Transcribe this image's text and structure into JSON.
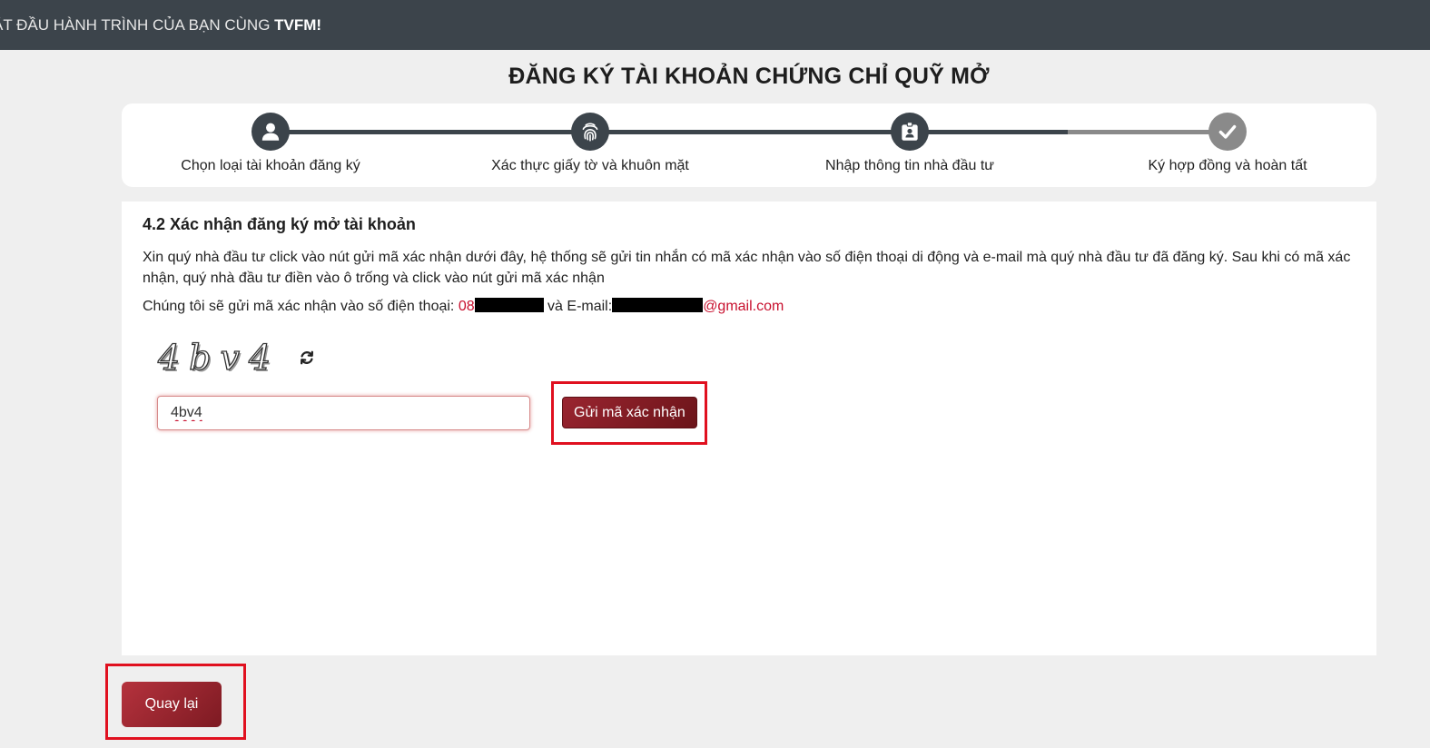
{
  "topbar": {
    "text_prefix": "ẮT ĐẦU HÀNH TRÌNH CỦA BẠN CÙNG ",
    "brand": "TVFM!"
  },
  "page_title": "ĐĂNG KÝ TÀI KHOẢN CHỨNG CHỈ QUỸ MỞ",
  "steps": [
    {
      "label": "Chọn loại tài khoản đăng ký",
      "icon": "user-icon",
      "status": "done"
    },
    {
      "label": "Xác thực giấy tờ và khuôn mặt",
      "icon": "fingerprint-icon",
      "status": "done"
    },
    {
      "label": "Nhập thông tin nhà đầu tư",
      "icon": "id-badge-icon",
      "status": "done"
    },
    {
      "label": "Ký hợp đồng và hoàn tất",
      "icon": "check-icon",
      "status": "pending"
    }
  ],
  "section": {
    "title": "4.2 Xác nhận đăng ký mở tài khoản",
    "instructions": "Xin quý nhà đầu tư click vào nút gửi mã xác nhận dưới đây, hệ thống sẽ gửi tin nhắn có mã xác nhận vào số điện thoại di động và e-mail mà quý nhà đầu tư đã đăng ký. Sau khi có mã xác nhận, quý nhà đầu tư điền vào ô trống và click vào nút gửi mã xác nhận",
    "send_info_prefix": "Chúng tôi sẽ gửi mã xác nhận vào số điện thoại: ",
    "phone_visible": "08",
    "email_prefix": " và E-mail:",
    "email_domain": "@gmail.com"
  },
  "captcha": {
    "text": "4bv4",
    "refresh_icon": "refresh-icon",
    "input_value": "4bv4"
  },
  "buttons": {
    "send_code": "Gửi mã xác nhận",
    "back": "Quay lại"
  },
  "colors": {
    "topbar": "#3c444b",
    "accent": "#8b1e28",
    "link_red": "#c8102e",
    "highlight": "#e0101f",
    "step_done": "#3c444b",
    "step_pending": "#8a8a8a"
  }
}
